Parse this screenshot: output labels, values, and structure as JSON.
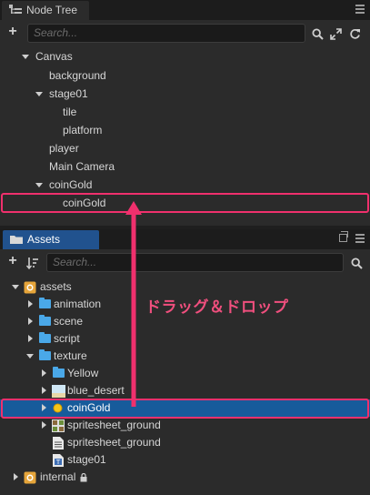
{
  "node_tree": {
    "tab_label": "Node Tree",
    "search_placeholder": "Search...",
    "nodes": [
      {
        "label": "Canvas"
      },
      {
        "label": "background"
      },
      {
        "label": "stage01"
      },
      {
        "label": "tile"
      },
      {
        "label": "platform"
      },
      {
        "label": "player"
      },
      {
        "label": "Main Camera"
      },
      {
        "label": "coinGold"
      },
      {
        "label": "coinGold"
      }
    ]
  },
  "assets": {
    "tab_label": "Assets",
    "search_placeholder": "Search...",
    "items": [
      {
        "label": "assets"
      },
      {
        "label": "animation"
      },
      {
        "label": "scene"
      },
      {
        "label": "script"
      },
      {
        "label": "texture"
      },
      {
        "label": "Yellow"
      },
      {
        "label": "blue_desert"
      },
      {
        "label": "coinGold"
      },
      {
        "label": "spritesheet_ground"
      },
      {
        "label": "spritesheet_ground"
      },
      {
        "label": "stage01"
      },
      {
        "label": "internal"
      }
    ]
  },
  "annotation": {
    "label": "ドラッグ＆ドロップ",
    "color": "#f0306d"
  },
  "colors": {
    "panel_bg": "#2b2b2b",
    "selection": "#175b9b",
    "assets_tab": "#21528e",
    "folder": "#4aa8e8"
  }
}
